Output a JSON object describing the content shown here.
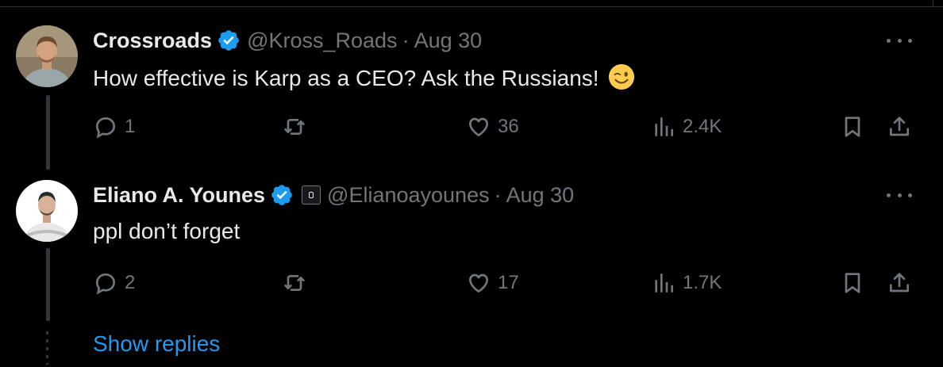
{
  "tweets": [
    {
      "name": "Crossroads",
      "handle": "@Kross_Roads",
      "separator": "·",
      "date": "Aug 30",
      "text": "How effective is Karp as a CEO? Ask the Russians!",
      "emoji": "winking-face",
      "replies": "1",
      "reposts": "",
      "likes": "36",
      "views": "2.4K"
    },
    {
      "name": "Eliano A. Younes",
      "handle": "@Elianoayounes",
      "separator": "·",
      "date": "Aug 30",
      "text": "ppl don’t forget",
      "replies": "2",
      "reposts": "",
      "likes": "17",
      "views": "1.7K"
    }
  ],
  "show_replies_label": "Show replies",
  "colors": {
    "background": "#000000",
    "text": "#e7e9ea",
    "secondary": "#71767b",
    "accent": "#1d9bf0",
    "thread_line": "#333639"
  }
}
